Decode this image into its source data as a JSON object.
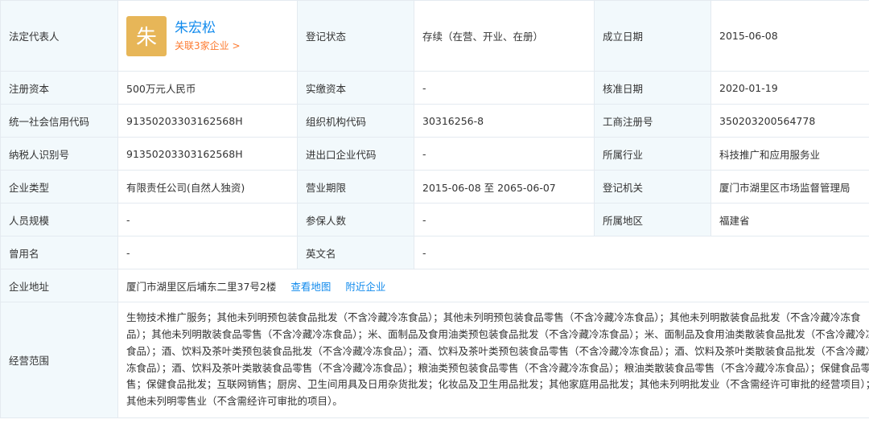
{
  "rows": {
    "r1": {
      "legal_rep_label": "法定代表人",
      "avatar_char": "朱",
      "legal_rep_name": "朱宏松",
      "legal_rep_assoc": "关联3家企业 >",
      "reg_status_label": "登记状态",
      "reg_status_value": "存续（在营、开业、在册）",
      "est_date_label": "成立日期",
      "est_date_value": "2015-06-08"
    },
    "r2": {
      "reg_capital_label": "注册资本",
      "reg_capital_value": "500万元人民币",
      "paid_capital_label": "实缴资本",
      "paid_capital_value": "-",
      "approve_date_label": "核准日期",
      "approve_date_value": "2020-01-19"
    },
    "r3": {
      "credit_code_label": "统一社会信用代码",
      "credit_code_value": "91350203303162568H",
      "org_code_label": "组织机构代码",
      "org_code_value": "30316256-8",
      "biz_reg_no_label": "工商注册号",
      "biz_reg_no_value": "350203200564778"
    },
    "r4": {
      "taxpayer_id_label": "纳税人识别号",
      "taxpayer_id_value": "91350203303162568H",
      "import_export_label": "进出口企业代码",
      "import_export_value": "-",
      "industry_label": "所属行业",
      "industry_value": "科技推广和应用服务业"
    },
    "r5": {
      "company_type_label": "企业类型",
      "company_type_value": "有限责任公司(自然人独资)",
      "biz_term_label": "营业期限",
      "biz_term_value": "2015-06-08 至 2065-06-07",
      "reg_authority_label": "登记机关",
      "reg_authority_value": "厦门市湖里区市场监督管理局"
    },
    "r6": {
      "staff_size_label": "人员规模",
      "staff_size_value": "-",
      "insured_label": "参保人数",
      "insured_value": "-",
      "region_label": "所属地区",
      "region_value": "福建省"
    },
    "r7": {
      "former_name_label": "曾用名",
      "former_name_value": "-",
      "english_name_label": "英文名",
      "english_name_value": "-"
    },
    "r8": {
      "address_label": "企业地址",
      "address_value": "厦门市湖里区后埔东二里37号2楼",
      "view_map": "查看地图",
      "nearby": "附近企业"
    },
    "r9": {
      "scope_label": "经营范围",
      "scope_value": "生物技术推广服务；其他未列明预包装食品批发（不含冷藏冷冻食品）；其他未列明预包装食品零售（不含冷藏冷冻食品）；其他未列明散装食品批发（不含冷藏冷冻食品）；其他未列明散装食品零售（不含冷藏冷冻食品）；米、面制品及食用油类预包装食品批发（不含冷藏冷冻食品）；米、面制品及食用油类散装食品批发（不含冷藏冷冻食品）；酒、饮料及茶叶类预包装食品批发（不含冷藏冷冻食品）；酒、饮料及茶叶类预包装食品零售（不含冷藏冷冻食品）；酒、饮料及茶叶类散装食品批发（不含冷藏冷冻食品）；酒、饮料及茶叶类散装食品零售（不含冷藏冷冻食品）；粮油类预包装食品零售（不含冷藏冷冻食品）；粮油类散装食品零售（不含冷藏冷冻食品）；保健食品零售；保健食品批发；互联网销售；厨房、卫生间用具及日用杂货批发；化妆品及卫生用品批发；其他家庭用品批发；其他未列明批发业（不含需经许可审批的经营项目）；其他未列明零售业（不含需经许可审批的项目）。"
    }
  },
  "colors": {
    "label_bg": "#f2f9fc",
    "border": "#e4eaf0",
    "link": "#128bed",
    "orange": "#fd7a2f",
    "avatar_bg": "#e7b658"
  }
}
